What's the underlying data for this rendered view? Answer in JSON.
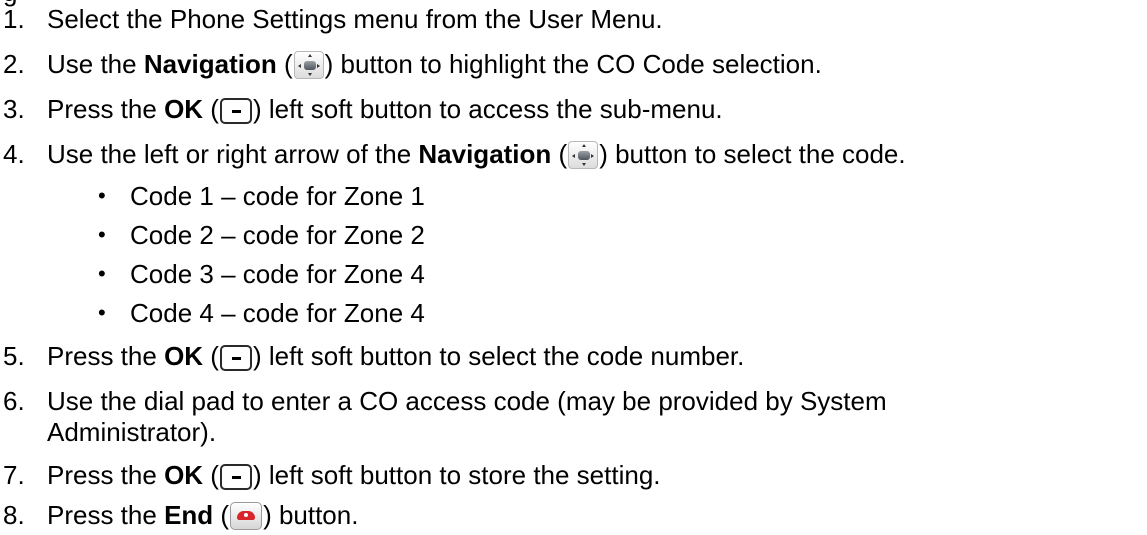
{
  "top_fragment": "g",
  "steps": [
    {
      "num": "1.",
      "text": "Select the Phone Settings menu from the User Menu."
    },
    {
      "num": "2.",
      "pre": "Use the ",
      "bold": "Navigation",
      "open": " (",
      "close": ") button to highlight the CO Code selection."
    },
    {
      "num": "3.",
      "pre": "Press the ",
      "bold": "OK",
      "open": " (",
      "close": ") left soft button to access the sub-menu."
    },
    {
      "num": "4.",
      "pre": "Use the left or right arrow of the ",
      "bold": "Navigation",
      "open": " (",
      "close": ") button to select the code."
    },
    {
      "num": "5.",
      "pre": "Press the ",
      "bold": "OK",
      "open": " (",
      "close": ") left soft button to select the code number."
    },
    {
      "num": "6.",
      "text": "Use the dial pad to enter a CO access code (may be provided by System",
      "cont": "Administrator)."
    },
    {
      "num": "7.",
      "pre": "Press the ",
      "bold": "OK",
      "open": " (",
      "close": ") left soft button to store the setting."
    },
    {
      "num": "8.",
      "pre": "Press the ",
      "bold": "End",
      "open": " (",
      "close": ") button."
    }
  ],
  "codes": [
    {
      "bullet": "•",
      "text": "Code 1 – code for Zone 1"
    },
    {
      "bullet": "•",
      "text": "Code 2 – code for Zone 2"
    },
    {
      "bullet": "•",
      "text": "Code 3 – code for Zone 4"
    },
    {
      "bullet": "•",
      "text": "Code 4 – code for Zone 4"
    }
  ],
  "icons": {
    "navigation": "navigation-button-icon",
    "ok": "ok-soft-button-icon",
    "end": "end-call-button-icon",
    "end_color": "#d8262b"
  }
}
